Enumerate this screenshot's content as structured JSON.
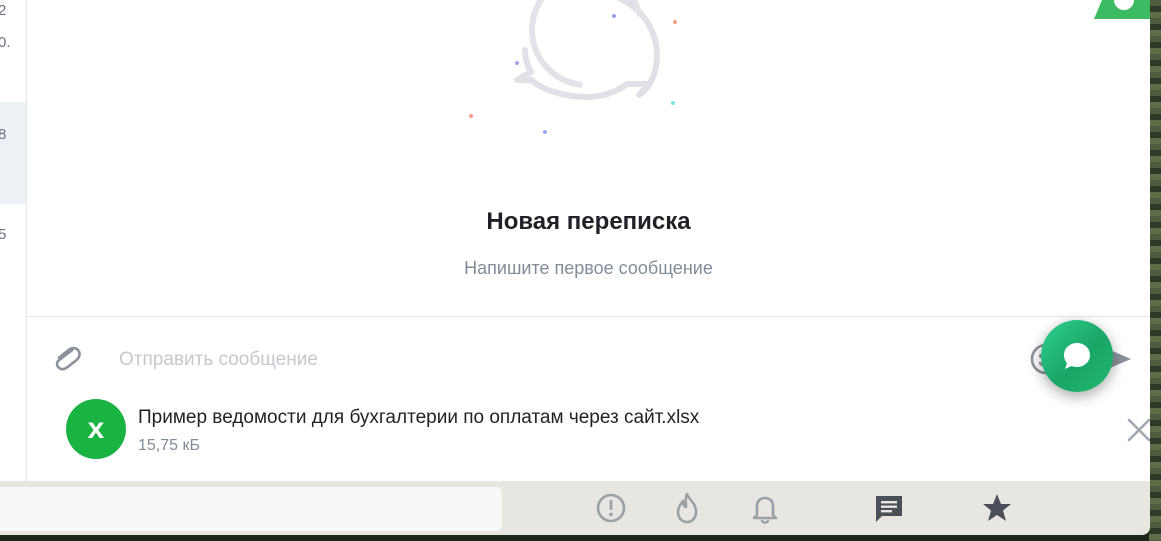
{
  "chat": {
    "empty_title": "Новая переписка",
    "empty_subtitle": "Напишите первое сообщение"
  },
  "composer": {
    "placeholder": "Отправить сообщение"
  },
  "attachment": {
    "file_icon_letter": "x",
    "file_name": "Пример ведомости для бухгалтерии по оплатам через сайт.xlsx",
    "file_size": "15,75 кБ"
  },
  "left_strip": {
    "fragments": [
      "2",
      "0.",
      "8",
      "5"
    ]
  },
  "tab_bar": {
    "icons": [
      "alert-icon",
      "fire-icon",
      "bell-icon",
      "chat-icon",
      "star-icon"
    ]
  },
  "colors": {
    "file_green": "#19b342",
    "fab_green": "#22b86e",
    "muted_text": "#818c99",
    "tab_bar_bg": "#e8e6e1"
  }
}
